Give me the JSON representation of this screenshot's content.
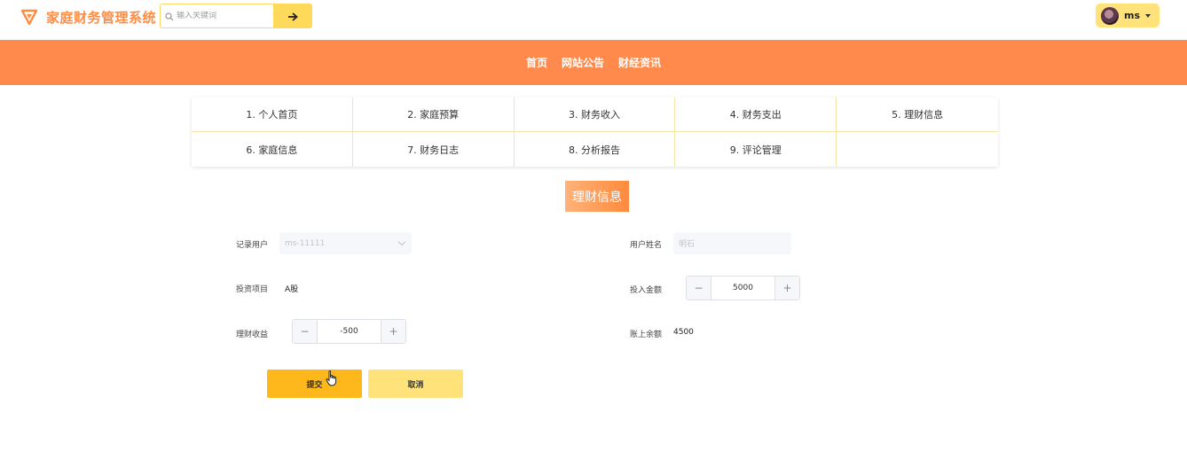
{
  "app": {
    "title": "家庭财务管理系统"
  },
  "search": {
    "placeholder": "输入关键词"
  },
  "user": {
    "name": "ms"
  },
  "nav": {
    "items": [
      "首页",
      "网站公告",
      "财经资讯"
    ]
  },
  "menu": {
    "items": [
      "1. 个人首页",
      "2. 家庭预算",
      "3. 财务收入",
      "4. 财务支出",
      "5. 理财信息",
      "6. 家庭信息",
      "7. 财务日志",
      "8. 分析报告",
      "9. 评论管理"
    ]
  },
  "section": {
    "title": "理财信息"
  },
  "form": {
    "record_user_label": "记录用户",
    "record_user_value": "ms-11111",
    "user_name_label": "用户姓名",
    "user_name_value": "明石",
    "project_label": "投资项目",
    "project_value": "A股",
    "amount_label": "投入金额",
    "amount_value": "5000",
    "income_label": "理财收益",
    "income_value": "-500",
    "balance_label": "账上余额",
    "balance_value": "4500",
    "minus": "−",
    "plus": "+",
    "submit_label": "提交",
    "cancel_label": "取消"
  },
  "colors": {
    "accent": "#ff8a4c",
    "brand_text": "#ff8c42",
    "button_primary": "#ffb81c",
    "button_secondary": "#ffe27a"
  }
}
